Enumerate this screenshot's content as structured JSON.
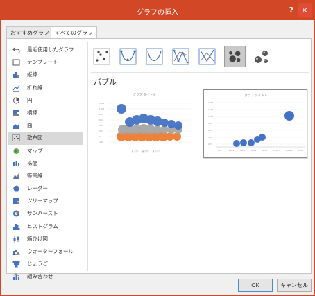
{
  "dialog": {
    "title": "グラフの挿入",
    "help_label": "?",
    "close_label": "×"
  },
  "tabs": [
    {
      "label": "おすすめグラフ"
    },
    {
      "label": "すべてのグラフ"
    }
  ],
  "sidebar": {
    "items": [
      {
        "label": "最近使用したグラフ",
        "icon": "undo-icon"
      },
      {
        "label": "テンプレート",
        "icon": "template-icon"
      },
      {
        "label": "縦棒",
        "icon": "column-chart-icon"
      },
      {
        "label": "折れ線",
        "icon": "line-chart-icon"
      },
      {
        "label": "円",
        "icon": "pie-chart-icon"
      },
      {
        "label": "横棒",
        "icon": "bar-chart-icon"
      },
      {
        "label": "面",
        "icon": "area-chart-icon"
      },
      {
        "label": "散布図",
        "icon": "scatter-chart-icon"
      },
      {
        "label": "マップ",
        "icon": "map-icon"
      },
      {
        "label": "株価",
        "icon": "stock-chart-icon"
      },
      {
        "label": "等高線",
        "icon": "surface-chart-icon"
      },
      {
        "label": "レーダー",
        "icon": "radar-chart-icon"
      },
      {
        "label": "ツリーマップ",
        "icon": "treemap-icon"
      },
      {
        "label": "サンバースト",
        "icon": "sunburst-icon"
      },
      {
        "label": "ヒストグラム",
        "icon": "histogram-icon"
      },
      {
        "label": "箱ひげ図",
        "icon": "box-whisker-icon"
      },
      {
        "label": "ウォーターフォール",
        "icon": "waterfall-icon"
      },
      {
        "label": "じょうご",
        "icon": "funnel-icon"
      },
      {
        "label": "組み合わせ",
        "icon": "combo-chart-icon"
      }
    ],
    "selected": "散布図"
  },
  "chart_types": {
    "icons": [
      "scatter-markers-icon",
      "scatter-smooth-markers-icon",
      "scatter-smooth-icon",
      "scatter-straight-markers-icon",
      "scatter-straight-icon",
      "bubble-icon",
      "bubble-3d-icon"
    ],
    "selected": "bubble-icon"
  },
  "section_title": "バブル",
  "previews": [
    {
      "title": "グラフ タイトル"
    },
    {
      "title": "グラフ タイトル"
    }
  ],
  "buttons": {
    "ok": "OK",
    "cancel": "キャンセル"
  },
  "colors": {
    "accent": "#d24726",
    "bubble_blue": "#4472c4",
    "bubble_orange": "#ed7d31",
    "bubble_gray": "#a5a5a5"
  }
}
